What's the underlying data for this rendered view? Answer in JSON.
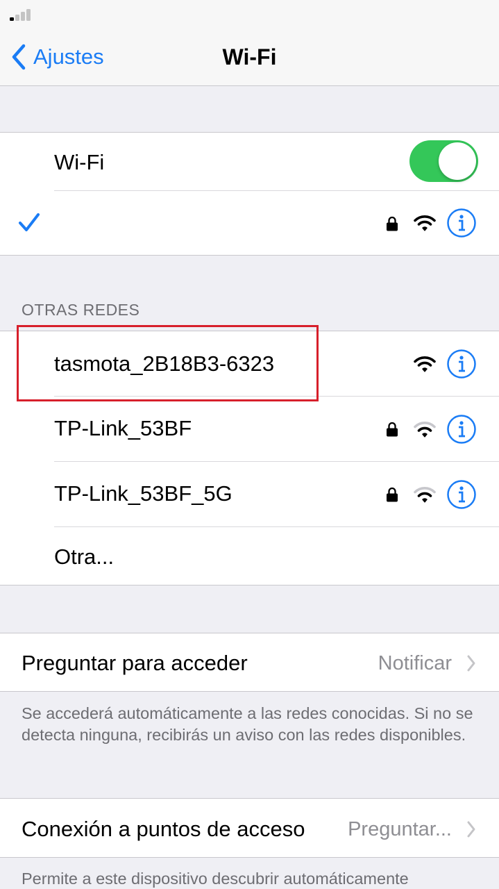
{
  "nav": {
    "back_label": "Ajustes",
    "title": "Wi-Fi"
  },
  "wifi_toggle": {
    "label": "Wi-Fi",
    "on": true,
    "accent": "#34c759"
  },
  "connected": {
    "name": "",
    "locked": true,
    "icons": [
      "checkmark-icon",
      "lock-icon",
      "wifi-icon",
      "info-icon"
    ]
  },
  "other_networks": {
    "header": "OTRAS REDES",
    "items": [
      {
        "name": "tasmota_2B18B3-6323",
        "locked": false,
        "signal": 3
      },
      {
        "name": "TP-Link_53BF",
        "locked": true,
        "signal": 2
      },
      {
        "name": "TP-Link_53BF_5G",
        "locked": true,
        "signal": 2
      }
    ],
    "other_label": "Otra..."
  },
  "ask_to_join": {
    "label": "Preguntar para acceder",
    "value": "Notificar",
    "footer": "Se accederá automáticamente a las redes conocidas. Si no se detecta ninguna, recibirás un aviso con las redes disponibles."
  },
  "hotspot": {
    "label": "Conexión a puntos de acceso",
    "value": "Preguntar...",
    "footer": "Permite a este dispositivo descubrir automáticamente"
  },
  "colors": {
    "accent": "#1a7cf5",
    "highlight": "#d71f2b"
  }
}
